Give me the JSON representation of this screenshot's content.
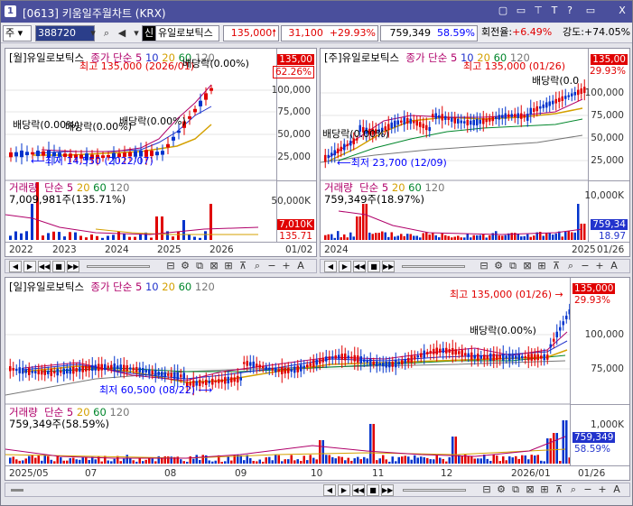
{
  "window": {
    "number": "1",
    "title": "[0613] 키움일주월차트 (KRX)",
    "buttons": [
      "▢",
      "▭",
      "⊤",
      "T",
      "?",
      "▭",
      "X"
    ]
  },
  "toolbar": {
    "type": "주",
    "code": "388720",
    "stock": "유일로보틱스",
    "market_badge": "신",
    "price": "135,000",
    "change": "31,100",
    "rate": "+29.93%",
    "volume": "759,349",
    "vol_rate": "58.59%",
    "turnover_label": "회전율:",
    "turnover": "+6.49%",
    "strength_label": "강도:",
    "strength": "+74.05%"
  },
  "monthly": {
    "title_name": "[월]유일로보틱스",
    "title_rest": "종가 단순",
    "ma": [
      "5",
      "10",
      "20",
      "60",
      "120"
    ],
    "axis": [
      "100,000",
      "75,000",
      "50,000",
      "25,000"
    ],
    "price_tag": "135,00",
    "pct_tag": "62.26%",
    "high": "최고 135,000 (2026/01)",
    "low": "최저 14,550 (2022/07)",
    "div": [
      "배당락(0.00%)",
      "배당락(0.00%)",
      "배당락(0.00%)",
      "배당락(0.00%)"
    ],
    "vol_title": "거래량",
    "vol_ma": [
      "단순",
      "5",
      "20",
      "60",
      "120"
    ],
    "vol_sub": "7,009,981주(135.71%)",
    "vol_axis": "50,000K",
    "vol_tag": "7,010K",
    "vol_tag2": "135.71",
    "x": [
      "2022",
      "2023",
      "2024",
      "2025",
      "2026"
    ],
    "x_end": "01/02"
  },
  "weekly": {
    "title_name": "[주]유일로보틱스",
    "title_rest": "종가 단순",
    "ma": [
      "5",
      "10",
      "20",
      "60",
      "120"
    ],
    "axis": [
      "100,000",
      "75,000",
      "50,000",
      "25,000"
    ],
    "price_tag": "135,00",
    "pct_tag": "29.93%",
    "high": "최고 135,000 (01/26)",
    "low": "최저 23,700 (12/09)",
    "div": [
      "배당락(0.00%)",
      "배당락(0.0"
    ],
    "vol_title": "거래량",
    "vol_ma": [
      "단순",
      "5",
      "20",
      "60",
      "120"
    ],
    "vol_sub": "759,349주(18.97%)",
    "vol_axis": "10,000K",
    "vol_tag": "759,34",
    "vol_tag2": "18.97",
    "x": [
      "2024",
      "2025"
    ],
    "x_end": "01/26"
  },
  "daily": {
    "title_name": "[일]유일로보틱스",
    "title_rest": "종가 단순",
    "ma": [
      "5",
      "10",
      "20",
      "60",
      "120"
    ],
    "axis": [
      "100,000",
      "75,000"
    ],
    "price_tag": "135,000",
    "pct_tag": "29.93%",
    "high": "최고 135,000 (01/26)",
    "low": "최저 60,500 (08/22)",
    "div": "배당락(0.00%)",
    "vol_title": "거래량",
    "vol_ma": [
      "단순",
      "5",
      "20",
      "60",
      "120"
    ],
    "vol_sub": "759,349주(58.59%)",
    "vol_axis": "1,000K",
    "vol_tag": "759,349",
    "vol_tag2": "58.59%",
    "x": [
      "2025/05",
      "07",
      "08",
      "09",
      "10",
      "11",
      "12",
      "2026/01"
    ],
    "x_end": "01/26"
  },
  "nav": {
    "buttons": [
      "◀",
      "▶",
      "◀◀",
      "■",
      "▶▶"
    ],
    "icons": [
      "⊟",
      "⚙",
      "⧉",
      "⊠",
      "⊞",
      "⊼",
      "⌕",
      "−",
      "+",
      "A"
    ]
  }
}
